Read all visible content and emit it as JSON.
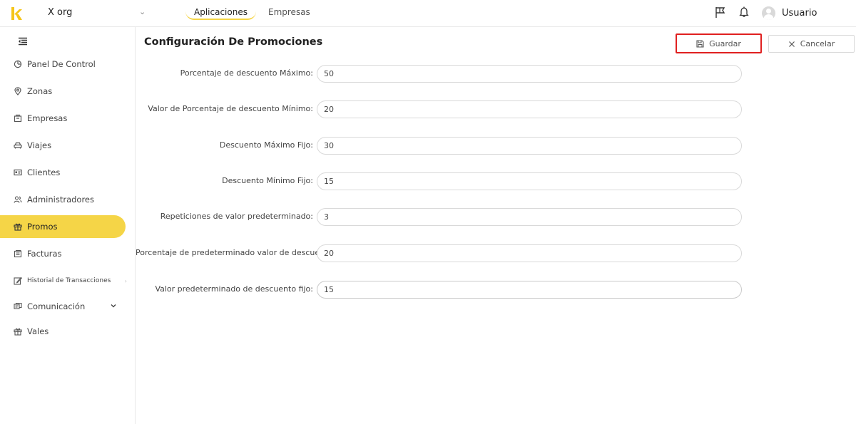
{
  "header": {
    "org_name": "X org",
    "tabs": [
      {
        "label": "Aplicaciones",
        "active": true
      },
      {
        "label": "Empresas",
        "active": false
      }
    ],
    "user_name": "Usuario"
  },
  "sidebar": {
    "items": [
      {
        "label": "Panel De Control",
        "icon": "pie-chart-icon"
      },
      {
        "label": "Zonas",
        "icon": "location-pin-icon"
      },
      {
        "label": "Empresas",
        "icon": "building-icon"
      },
      {
        "label": "Viajes",
        "icon": "car-icon"
      },
      {
        "label": "Clientes",
        "icon": "id-card-icon"
      },
      {
        "label": "Administradores",
        "icon": "users-icon"
      },
      {
        "label": "Promos",
        "icon": "gift-icon",
        "active": true
      },
      {
        "label": "Facturas",
        "icon": "invoice-icon"
      },
      {
        "label": "Historial de Transacciones",
        "icon": "edit-icon"
      },
      {
        "label": "Comunicación",
        "icon": "message-icon"
      },
      {
        "label": "Vales",
        "icon": "gift-icon"
      }
    ]
  },
  "main": {
    "title": "Configuración De Promociones",
    "save_label": "Guardar",
    "cancel_label": "Cancelar",
    "fields": [
      {
        "label": "Porcentaje de descuento Máximo",
        "value": "50"
      },
      {
        "label": "Valor de Porcentaje de descuento Mínimo",
        "value": "20"
      },
      {
        "label": "Descuento Máximo Fijo",
        "value": "30"
      },
      {
        "label": "Descuento Mínimo Fijo",
        "value": "15"
      },
      {
        "label": "Repeticiones de valor predeterminado",
        "value": "3"
      },
      {
        "label": "Porcentaje de predeterminado valor de descue",
        "value": "20"
      },
      {
        "label": "Valor predeterminado de descuento fijo",
        "value": "15"
      }
    ]
  },
  "colors": {
    "accent": "#f5d547",
    "highlight_border": "#e02020"
  }
}
